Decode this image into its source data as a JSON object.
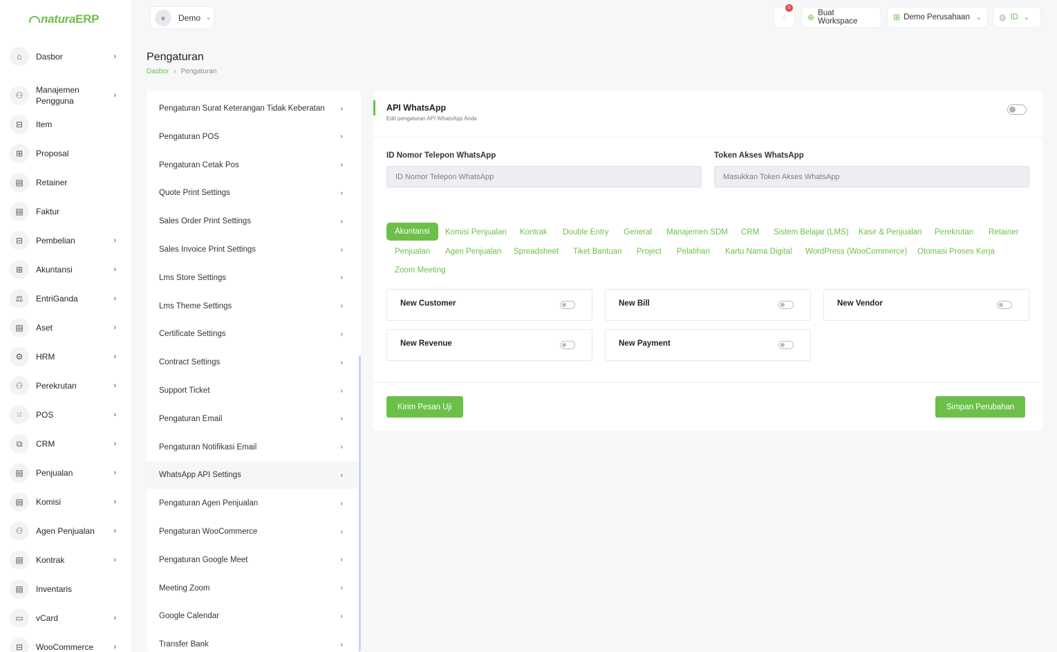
{
  "logo": {
    "natura": "natura",
    "erp": "ERP"
  },
  "sidebar": {
    "items": [
      {
        "label": "Dasbor",
        "icon": "home-icon",
        "glyph": "⌂",
        "chevron": true
      },
      {
        "label": "Manajemen Pengguna",
        "icon": "users-icon",
        "glyph": "⚇",
        "chevron": true
      },
      {
        "label": "Item",
        "icon": "cart-icon",
        "glyph": "⊟",
        "chevron": false
      },
      {
        "label": "Proposal",
        "icon": "proposal-icon",
        "glyph": "⊞",
        "chevron": false
      },
      {
        "label": "Retainer",
        "icon": "retainer-icon",
        "glyph": "▤",
        "chevron": false
      },
      {
        "label": "Faktur",
        "icon": "invoice-icon",
        "glyph": "▤",
        "chevron": false
      },
      {
        "label": "Pembelian",
        "icon": "purchase-icon",
        "glyph": "⊟",
        "chevron": true
      },
      {
        "label": "Akuntansi",
        "icon": "accounting-icon",
        "glyph": "⊞",
        "chevron": true
      },
      {
        "label": "EntriGanda",
        "icon": "scale-icon",
        "glyph": "⚖",
        "chevron": true
      },
      {
        "label": "Aset",
        "icon": "asset-icon",
        "glyph": "▤",
        "chevron": true
      },
      {
        "label": "HRM",
        "icon": "hrm-icon",
        "glyph": "⚙",
        "chevron": true
      },
      {
        "label": "Perekrutan",
        "icon": "user-plus-icon",
        "glyph": "⚇",
        "chevron": true
      },
      {
        "label": "POS",
        "icon": "grid-icon",
        "glyph": "⁙",
        "chevron": true
      },
      {
        "label": "CRM",
        "icon": "crm-icon",
        "glyph": "⧉",
        "chevron": true
      },
      {
        "label": "Penjualan",
        "icon": "sales-icon",
        "glyph": "▤",
        "chevron": true
      },
      {
        "label": "Komisi",
        "icon": "commission-icon",
        "glyph": "▤",
        "chevron": true
      },
      {
        "label": "Agen Penjualan",
        "icon": "agent-icon",
        "glyph": "⚇",
        "chevron": true
      },
      {
        "label": "Kontrak",
        "icon": "contract-icon",
        "glyph": "▤",
        "chevron": true
      },
      {
        "label": "Inventaris",
        "icon": "inventory-icon",
        "glyph": "▤",
        "chevron": false
      },
      {
        "label": "vCard",
        "icon": "vcard-icon",
        "glyph": "▭",
        "chevron": true
      },
      {
        "label": "WooCommerce",
        "icon": "woocommerce-icon",
        "glyph": "⊟",
        "chevron": true
      }
    ]
  },
  "topbar": {
    "user_name": "Demo",
    "notification_count": "0",
    "workspace_button": "Buat Workspace",
    "company_selector": "Demo Perusahaan",
    "language": "ID"
  },
  "page": {
    "title": "Pengaturan",
    "breadcrumb": [
      "Dasbor",
      "Pengaturan"
    ]
  },
  "settings_menu": {
    "items": [
      "Pengaturan Surat Keterangan Tidak Keberatan",
      "Pengaturan POS",
      "Pengaturan Cetak Pos",
      "Quote Print Settings",
      "Sales Order Print Settings",
      "Sales Invoice Print Settings",
      "Lms Store Settings",
      "Lms Theme Settings",
      "Certificate Settings",
      "Contract Settings",
      "Support Ticket",
      "Pengaturan Email",
      "Pengaturan Notifikasi Email",
      "WhatsApp API Settings",
      "Pengaturan Agen Penjualan",
      "Pengaturan WooCommerce",
      "Pengaturan Google Meet",
      "Meeting Zoom",
      "Google Calendar",
      "Transfer Bank"
    ],
    "active_index": 13
  },
  "card": {
    "title": "API WhatsApp",
    "subtitle": "Edit pengaturan API WhatsApp Anda",
    "enabled": false,
    "phone_label": "ID Nomor Telepon WhatsApp",
    "phone_placeholder": "ID Nomor Telepon WhatsApp",
    "token_label": "Token Akses WhatsApp",
    "token_placeholder": "Masukkan Token Akses WhatsApp",
    "tabs": [
      "Akuntansi",
      "Komisi Penjualan",
      "Kontrak",
      "Double Entry",
      "General",
      "Manajemen SDM",
      "CRM",
      "Sistem Belajar (LMS)",
      "Kasir & Penjualan",
      "Perekrutan",
      "Retainer",
      "Penjualan",
      "Agen Penjualan",
      "Spreadsheet",
      "Tiket Bantuan",
      "Project",
      "Pelatihan",
      "Kartu Nama Digital",
      "WordPress (WooCommerce)",
      "Otomasi Proses Kerja",
      "Zoom Meeting"
    ],
    "active_tab": 0,
    "notifications": [
      {
        "label": "New Customer",
        "enabled": false
      },
      {
        "label": "New Bill",
        "enabled": false
      },
      {
        "label": "New Vendor",
        "enabled": false
      },
      {
        "label": "New Revenue",
        "enabled": false
      },
      {
        "label": "New Payment",
        "enabled": false
      }
    ],
    "test_button": "Kirim Pesan Uji",
    "save_button": "Simpan Perubahan"
  },
  "colors": {
    "accent": "#6cc04a",
    "badge": "#e5484d"
  }
}
